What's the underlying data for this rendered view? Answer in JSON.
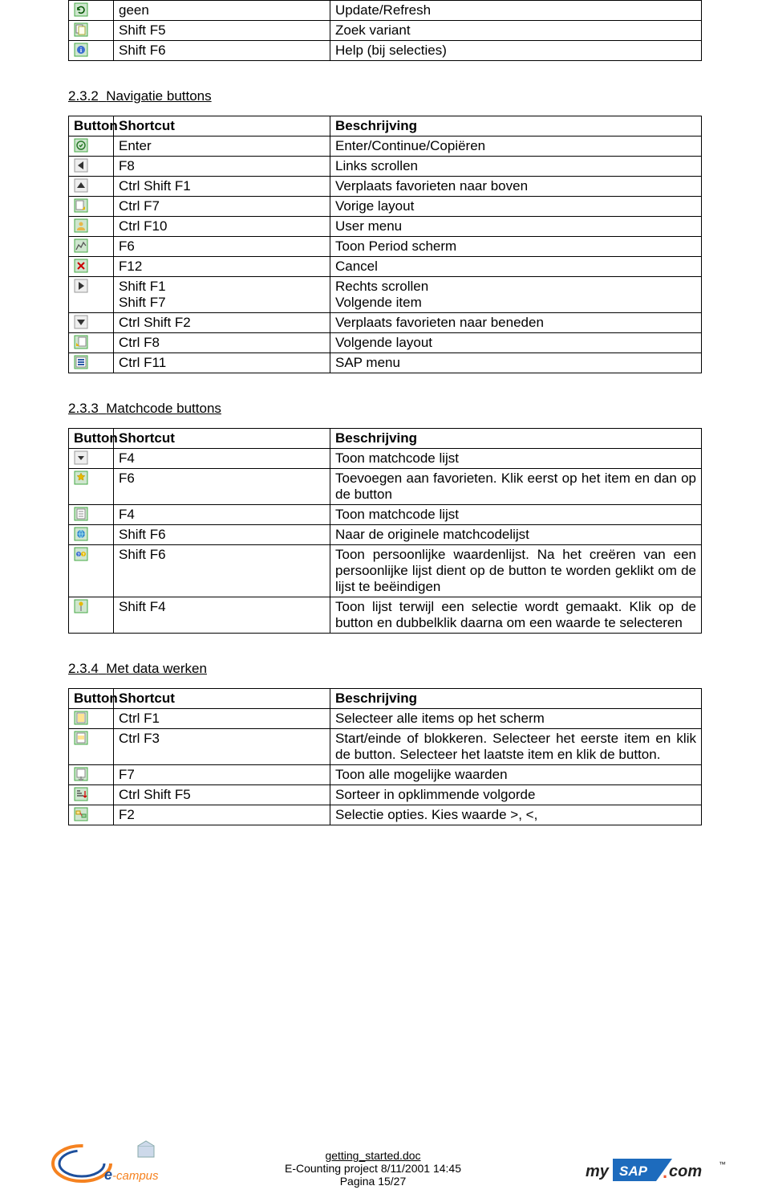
{
  "table0": {
    "rows": [
      {
        "icon": "refresh-icon",
        "shortcut": "geen",
        "desc": "Update/Refresh"
      },
      {
        "icon": "variant-icon",
        "shortcut": "Shift F5",
        "desc": "Zoek variant"
      },
      {
        "icon": "info-icon",
        "shortcut": "Shift F6",
        "desc": "Help (bij selecties)"
      }
    ]
  },
  "sec1": {
    "num": "2.3.2",
    "title": "Navigatie buttons"
  },
  "headers": {
    "button": "Button",
    "shortcut": "Shortcut",
    "desc": "Beschrijving"
  },
  "table1": {
    "rows": [
      {
        "icon": "enter-icon",
        "shortcut": "Enter",
        "desc": "Enter/Continue/Copiëren"
      },
      {
        "icon": "left-icon",
        "shortcut": "F8",
        "desc": "Links scrollen"
      },
      {
        "icon": "up-icon",
        "shortcut": "Ctrl Shift F1",
        "desc": "Verplaats favorieten naar boven"
      },
      {
        "icon": "prev-layout-icon",
        "shortcut": "Ctrl F7",
        "desc": "Vorige layout"
      },
      {
        "icon": "user-menu-icon",
        "shortcut": "Ctrl F10",
        "desc": "User menu"
      },
      {
        "icon": "period-icon",
        "shortcut": "F6",
        "desc": "Toon Period scherm"
      },
      {
        "icon": "cancel-icon",
        "shortcut": "F12",
        "desc": "Cancel"
      },
      {
        "icon": "right-icon",
        "shortcut": "Shift F1\nShift F7",
        "desc": "Rechts scrollen\nVolgende item"
      },
      {
        "icon": "down-icon",
        "shortcut": "Ctrl Shift F2",
        "desc": "Verplaats favorieten naar beneden"
      },
      {
        "icon": "next-layout-icon",
        "shortcut": "Ctrl F8",
        "desc": "Volgende layout"
      },
      {
        "icon": "sap-menu-icon",
        "shortcut": "Ctrl F11",
        "desc": "SAP menu"
      }
    ]
  },
  "sec2": {
    "num": "2.3.3",
    "title": "Matchcode buttons"
  },
  "table2": {
    "rows": [
      {
        "icon": "dropdown-icon",
        "shortcut": "F4",
        "desc": "Toon matchcode lijst"
      },
      {
        "icon": "add-fav-icon",
        "shortcut": "F6",
        "desc": "Toevoegen aan favorieten. Klik eerst op het item en dan op de button"
      },
      {
        "icon": "list-icon",
        "shortcut": "F4",
        "desc": "Toon matchcode lijst"
      },
      {
        "icon": "globe-icon",
        "shortcut": "Shift F6",
        "desc": "Naar de originele matchcodelijst"
      },
      {
        "icon": "personal-icon",
        "shortcut": "Shift F6",
        "desc": "Toon persoonlijke waardenlijst. Na het creëren van een persoonlijke lijst dient op de button te worden geklikt om de lijst te beëindigen"
      },
      {
        "icon": "pin-icon",
        "shortcut": "Shift F4",
        "desc": "Toon lijst terwijl een selectie wordt gemaakt. Klik op de button en dubbelklik daarna om een waarde te selecteren"
      }
    ]
  },
  "sec3": {
    "num": "2.3.4",
    "title": "Met data werken"
  },
  "table3": {
    "rows": [
      {
        "icon": "select-all-icon",
        "shortcut": "Ctrl F1",
        "desc": "Selecteer alle items op het scherm"
      },
      {
        "icon": "block-icon",
        "shortcut": "Ctrl F3",
        "desc": "Start/einde of blokkeren. Selecteer het eerste item en klik de button. Selecteer het laatste item en klik de button."
      },
      {
        "icon": "show-values-icon",
        "shortcut": "F7",
        "desc": "Toon alle mogelijke waarden"
      },
      {
        "icon": "sort-icon",
        "shortcut": "Ctrl Shift F5",
        "desc": "Sorteer in opklimmende volgorde"
      },
      {
        "icon": "sel-opts-icon",
        "shortcut": "F2",
        "desc": "Selectie opties. Kies waarde >, <,"
      }
    ]
  },
  "footer": {
    "doc": "getting_started.doc",
    "line2": "E-Counting project   8/11/2001   14:45",
    "page": "Pagina 15/27"
  }
}
